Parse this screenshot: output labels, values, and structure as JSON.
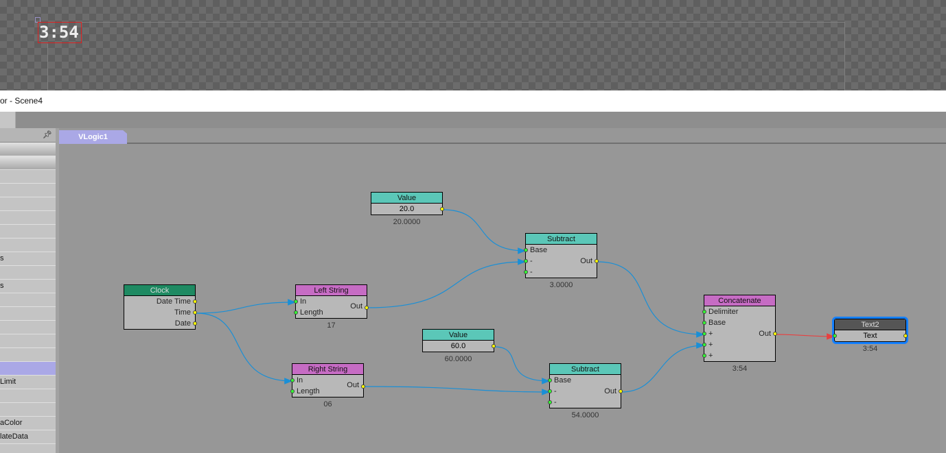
{
  "preview": {
    "text": "3:54"
  },
  "window": {
    "title": "or - Scene4"
  },
  "sidebar": {
    "pin_icon": "pin-icon",
    "rows": [
      "",
      "",
      "",
      "",
      "",
      "",
      "s",
      "",
      "s",
      "",
      "",
      "",
      "",
      "",
      "",
      "Limit",
      "",
      "",
      "aColor",
      "lateData"
    ],
    "selected_index": 14
  },
  "editor": {
    "tab": "VLogic1"
  },
  "nodes": {
    "value1": {
      "title": "Value",
      "value": "20.0",
      "result": "20.0000"
    },
    "subtract1": {
      "title": "Subtract",
      "inputs": [
        "Base",
        "-",
        "-"
      ],
      "output": "Out",
      "result": "3.0000"
    },
    "clock": {
      "title": "Clock",
      "outputs": [
        "Date Time",
        "Time",
        "Date"
      ]
    },
    "left_string": {
      "title": "Left String",
      "inputs": [
        "In",
        "Length"
      ],
      "output": "Out",
      "result": "17"
    },
    "right_string": {
      "title": "Right String",
      "inputs": [
        "In",
        "Length"
      ],
      "output": "Out",
      "result": "06"
    },
    "value2": {
      "title": "Value",
      "value": "60.0",
      "result": "60.0000"
    },
    "subtract2": {
      "title": "Subtract",
      "inputs": [
        "Base",
        "-",
        "-"
      ],
      "output": "Out",
      "result": "54.0000"
    },
    "concatenate": {
      "title": "Concatenate",
      "inputs": [
        "Delimiter",
        "Base",
        "+",
        "+",
        "+"
      ],
      "output": "Out",
      "result": "3:54"
    },
    "text2": {
      "title": "Text2",
      "input": "Text",
      "result": "3:54"
    }
  },
  "colors": {
    "wire": "#1a8fd6",
    "active_wire": "#e84040",
    "selection": "#1480ff"
  }
}
